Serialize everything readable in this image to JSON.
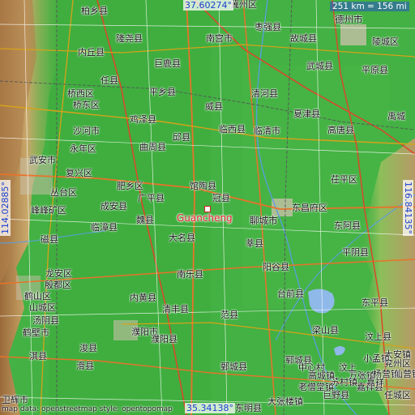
{
  "center": {
    "name": "Guancheng",
    "marker_color": "#cc2222"
  },
  "coordinates": {
    "top": "37.60274°",
    "bottom": "35.34138°",
    "left": "114.02885°",
    "right": "116.84135°"
  },
  "scale": "251 km = 156 mi",
  "attribution": "map data: openstreetmap style: opentopomap",
  "places": [
    {
      "name": "柏乡县"
    },
    {
      "name": "冀州区"
    },
    {
      "name": "枣强县"
    },
    {
      "name": "德州市"
    },
    {
      "name": "隆尧县"
    },
    {
      "name": "南宫市"
    },
    {
      "name": "故城县"
    },
    {
      "name": "陵城区"
    },
    {
      "name": "内丘县"
    },
    {
      "name": "巨鹿县"
    },
    {
      "name": "武城县"
    },
    {
      "name": "平原县"
    },
    {
      "name": "任县"
    },
    {
      "name": "平乡县"
    },
    {
      "name": "清河县"
    },
    {
      "name": "桥西区"
    },
    {
      "name": "桥东区"
    },
    {
      "name": "威县"
    },
    {
      "name": "夏津县"
    },
    {
      "name": "禹城"
    },
    {
      "name": "沙河市"
    },
    {
      "name": "鸡泽县"
    },
    {
      "name": "临西县"
    },
    {
      "name": "临清市"
    },
    {
      "name": "高唐县"
    },
    {
      "name": "曲周县"
    },
    {
      "name": "邱县"
    },
    {
      "name": "永年区"
    },
    {
      "name": "武安市"
    },
    {
      "name": "复兴区"
    },
    {
      "name": "肥乡区"
    },
    {
      "name": "馆陶县"
    },
    {
      "name": "丛台区"
    },
    {
      "name": "广平县"
    },
    {
      "name": "冠县"
    },
    {
      "name": "茌平区"
    },
    {
      "name": "峰峰矿区"
    },
    {
      "name": "成安县"
    },
    {
      "name": "东昌府区"
    },
    {
      "name": "临漳县"
    },
    {
      "name": "魏县"
    },
    {
      "name": "聊城市"
    },
    {
      "name": "东阿县"
    },
    {
      "name": "大名县"
    },
    {
      "name": "磁县"
    },
    {
      "name": "莘县"
    },
    {
      "name": "平阴县"
    },
    {
      "name": "阳谷县"
    },
    {
      "name": "龙安区"
    },
    {
      "name": "南乐县"
    },
    {
      "name": "殷都区"
    },
    {
      "name": "鹤山区"
    },
    {
      "name": "台前县"
    },
    {
      "name": "内黄县"
    },
    {
      "name": "山城区"
    },
    {
      "name": "东平县"
    },
    {
      "name": "清丰县"
    },
    {
      "name": "汤阴县"
    },
    {
      "name": "范县"
    },
    {
      "name": "梁山县"
    },
    {
      "name": "鹤壁市"
    },
    {
      "name": "濮阳市"
    },
    {
      "name": "汶上县"
    },
    {
      "name": "淇县"
    },
    {
      "name": "浚县"
    },
    {
      "name": "濮阳县"
    },
    {
      "name": "大安镇"
    },
    {
      "name": "小孟镇"
    },
    {
      "name": "兖州区"
    },
    {
      "name": "滑县"
    },
    {
      "name": "鄄城县"
    },
    {
      "name": "郓城县"
    },
    {
      "name": "嘉祥县"
    },
    {
      "name": "任城区"
    },
    {
      "name": "巨野县"
    },
    {
      "name": "卫辉市"
    },
    {
      "name": "东明县"
    },
    {
      "name": "老僧堂镇"
    },
    {
      "name": "万张镇"
    },
    {
      "name": "苏村镇"
    },
    {
      "name": "高城镇"
    },
    {
      "name": "杨营镇"
    },
    {
      "name": "汶上"
    },
    {
      "name": "仙营镇"
    },
    {
      "name": "中心村"
    },
    {
      "name": "嘉祥"
    },
    {
      "name": "大张楼镇"
    }
  ]
}
